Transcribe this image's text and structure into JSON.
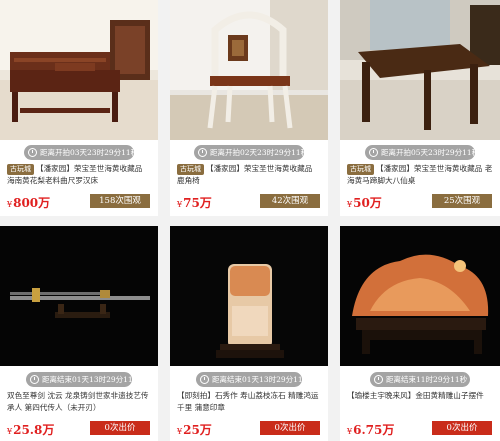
{
  "items": [
    {
      "timer": "距离开拍03天23时29分11秒",
      "tag": "古玩城",
      "title": "【潘家园】荣宝圣世海黄收藏品 海南黄花梨老料曲尺罗汉床",
      "price": "800万",
      "button": "158次围观"
    },
    {
      "timer": "距离开拍02天23时29分11秒",
      "tag": "古玩城",
      "title": "【潘家园】荣宝圣世海黄收藏品 鹿角椅",
      "price": "75万",
      "button": "42次围观"
    },
    {
      "timer": "距离开拍05天23时29分11秒",
      "tag": "古玩城",
      "title": "【潘家园】荣宝圣世海黄收藏品 老海黄马蹄脚大八仙桌",
      "price": "50万",
      "button": "25次围观"
    },
    {
      "timer": "距离结束01天13时29分11秒",
      "tag": "",
      "title": "双色至尊剑 沈云 龙泉铸剑世家非遗技艺传承人 第四代传人（未开刃）",
      "price": "25.8万",
      "button": "0次出价"
    },
    {
      "timer": "距离结束01天13时29分11秒",
      "tag": "",
      "title": "【即刻拍】石秀作 寿山荔枝冻石 精雕鸿运千里 蒲意印章",
      "price": "25万",
      "button": "0次出价"
    },
    {
      "timer": "距离结束11时29分11秒",
      "tag": "",
      "title": "【瑜楼主宇晚来风】金田黄精雕山子摆件",
      "price": "6.75万",
      "button": "0次出价"
    }
  ],
  "currency": "¥",
  "colors": {
    "gold": "#8a6d3f",
    "red": "#c92c1a",
    "price": "#e02020"
  }
}
